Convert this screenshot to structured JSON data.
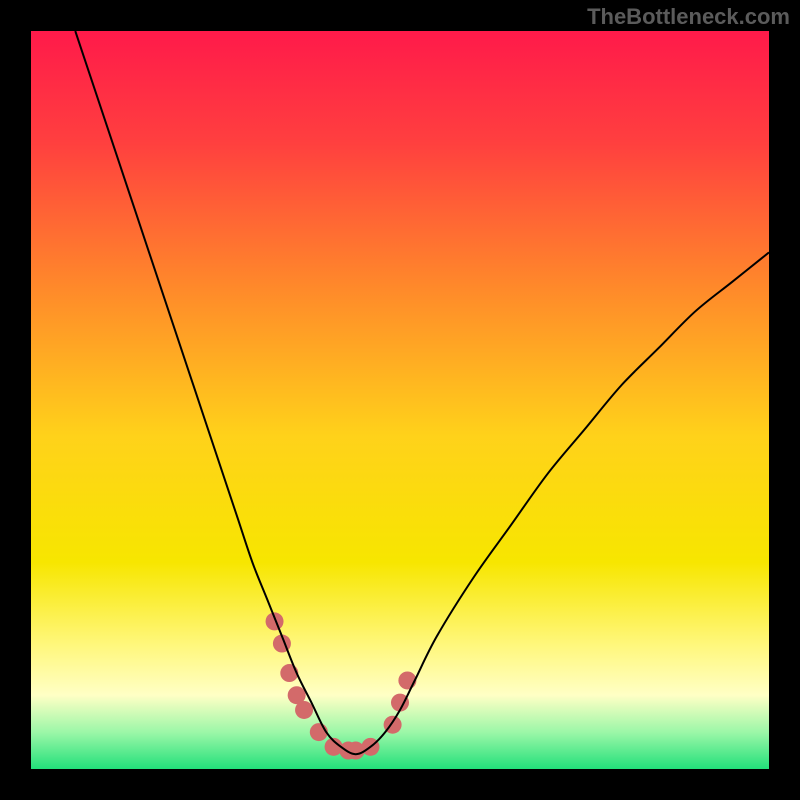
{
  "watermark": "TheBottleneck.com",
  "chart_data": {
    "type": "line",
    "title": "",
    "xlabel": "",
    "ylabel": "",
    "xlim": [
      0,
      100
    ],
    "ylim": [
      0,
      100
    ],
    "background_gradient": {
      "type": "vertical",
      "stops": [
        {
          "pos": 0.0,
          "color": "#ff1a4a"
        },
        {
          "pos": 0.15,
          "color": "#ff3f3f"
        },
        {
          "pos": 0.35,
          "color": "#ff8a2a"
        },
        {
          "pos": 0.55,
          "color": "#ffd21a"
        },
        {
          "pos": 0.72,
          "color": "#f7e600"
        },
        {
          "pos": 0.83,
          "color": "#fff77a"
        },
        {
          "pos": 0.9,
          "color": "#ffffc5"
        },
        {
          "pos": 0.95,
          "color": "#9cf7a8"
        },
        {
          "pos": 1.0,
          "color": "#22e07a"
        }
      ]
    },
    "series": [
      {
        "name": "bottleneck-curve",
        "color": "#000000",
        "width": 2,
        "x": [
          6,
          8,
          10,
          12,
          14,
          16,
          18,
          20,
          22,
          24,
          26,
          28,
          30,
          32,
          34,
          36,
          38,
          40,
          42,
          44,
          46,
          48,
          50,
          52,
          55,
          60,
          65,
          70,
          75,
          80,
          85,
          90,
          95,
          100
        ],
        "y": [
          100,
          94,
          88,
          82,
          76,
          70,
          64,
          58,
          52,
          46,
          40,
          34,
          28,
          23,
          18,
          13,
          9,
          5,
          3,
          2,
          3,
          5,
          8,
          12,
          18,
          26,
          33,
          40,
          46,
          52,
          57,
          62,
          66,
          70
        ]
      }
    ],
    "markers": {
      "name": "optimal-zone-dots",
      "color": "#d36a6a",
      "radius": 9,
      "points": [
        {
          "x": 33,
          "y": 20
        },
        {
          "x": 34,
          "y": 17
        },
        {
          "x": 35,
          "y": 13
        },
        {
          "x": 36,
          "y": 10
        },
        {
          "x": 37,
          "y": 8
        },
        {
          "x": 39,
          "y": 5
        },
        {
          "x": 41,
          "y": 3
        },
        {
          "x": 43,
          "y": 2.5
        },
        {
          "x": 44,
          "y": 2.5
        },
        {
          "x": 46,
          "y": 3
        },
        {
          "x": 49,
          "y": 6
        },
        {
          "x": 50,
          "y": 9
        },
        {
          "x": 51,
          "y": 12
        }
      ]
    }
  }
}
